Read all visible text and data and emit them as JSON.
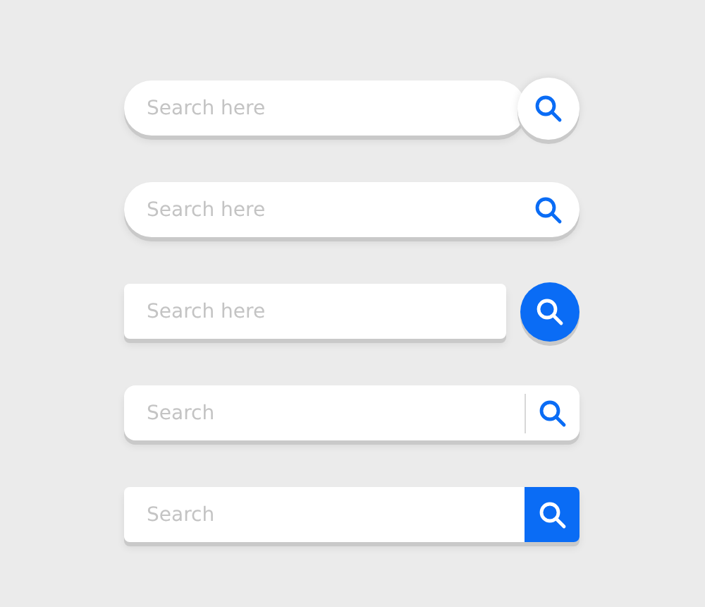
{
  "search_bars": [
    {
      "kind": "pill-circle",
      "placeholder": "Search here"
    },
    {
      "kind": "pill-inline",
      "placeholder": "Search here"
    },
    {
      "kind": "rect-circle",
      "placeholder": "Search here"
    },
    {
      "kind": "rect-divider",
      "placeholder": "Search"
    },
    {
      "kind": "rect-attached",
      "placeholder": "Search"
    }
  ]
}
